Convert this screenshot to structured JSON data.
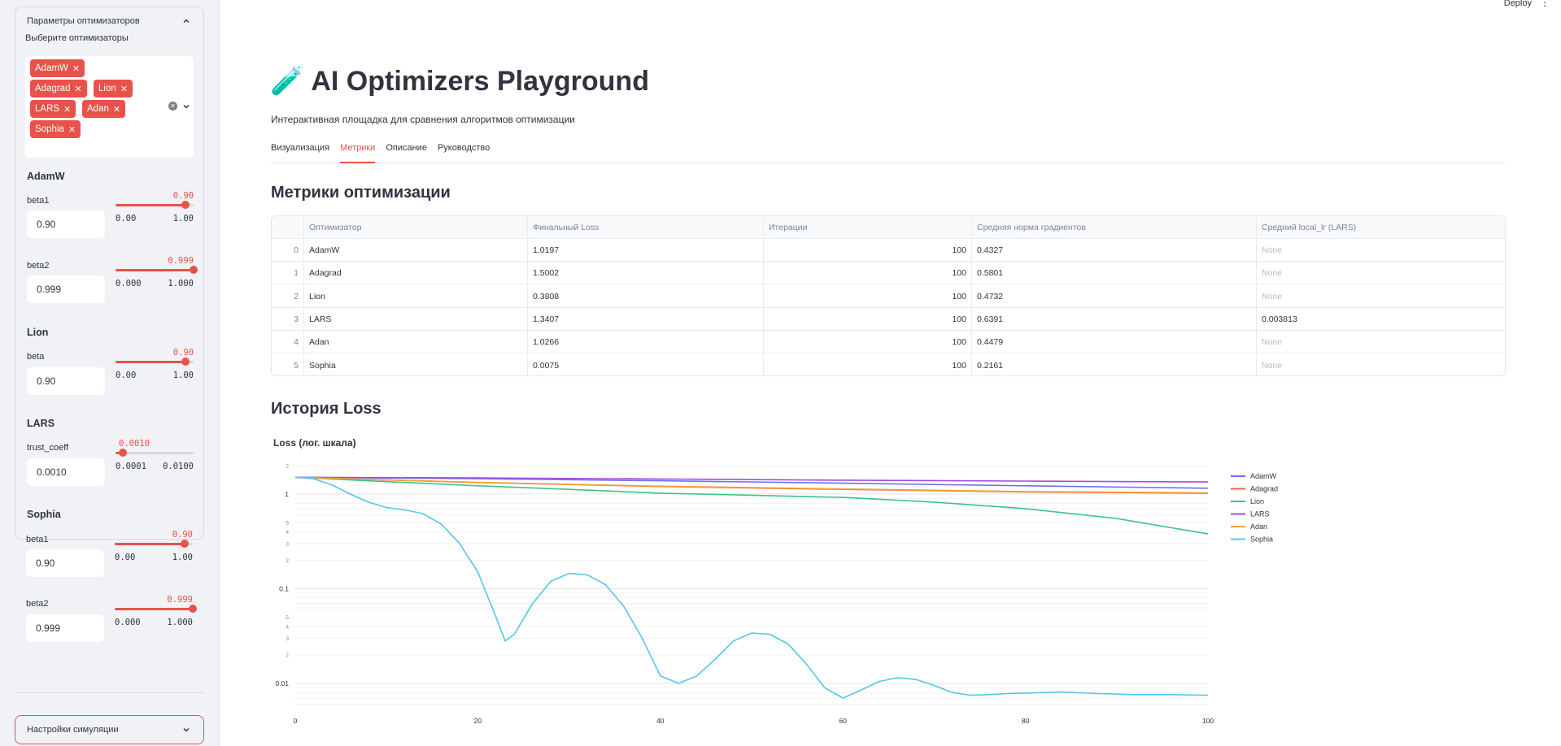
{
  "sidebar": {
    "expander_title": "Параметры оптимизаторов",
    "select_label": "Выберите оптимизаторы",
    "selected": [
      "AdamW",
      "Adagrad",
      "Lion",
      "LARS",
      "Adan",
      "Sophia"
    ],
    "groups": {
      "adamw": {
        "title": "AdamW",
        "beta1": {
          "label": "beta1",
          "value": "0.90",
          "slider_value": "0.90",
          "min": "0.00",
          "max": "1.00",
          "fraction": 0.9
        },
        "beta2": {
          "label": "beta2",
          "value": "0.999",
          "slider_value": "0.999",
          "min": "0.000",
          "max": "1.000",
          "fraction": 0.999
        }
      },
      "lion": {
        "title": "Lion",
        "beta": {
          "label": "beta",
          "value": "0.90",
          "slider_value": "0.90",
          "min": "0.00",
          "max": "1.00",
          "fraction": 0.9
        }
      },
      "lars": {
        "title": "LARS",
        "trust_coeff": {
          "label": "trust_coeff",
          "value": "0.0010",
          "slider_value": "0.0010",
          "min": "0.0001",
          "max": "0.0100",
          "fraction": 0.09
        }
      },
      "sophia": {
        "title": "Sophia",
        "beta1": {
          "label": "beta1",
          "value": "0.90",
          "slider_value": "0.90",
          "min": "0.00",
          "max": "1.00",
          "fraction": 0.9
        },
        "beta2": {
          "label": "beta2",
          "value": "0.999",
          "slider_value": "0.999",
          "min": "0.000",
          "max": "1.000",
          "fraction": 0.999
        }
      }
    },
    "sim_settings_title": "Настройки симуляции"
  },
  "header": {
    "deploy": "Deploy",
    "menu_icon": "⋮"
  },
  "main": {
    "title_icon": "🧪",
    "title": "AI Optimizers Playground",
    "subtitle": "Интерактивная площадка для сравнения алгоритмов оптимизации",
    "tabs": [
      {
        "label": "Визуализация"
      },
      {
        "label": "Метрики"
      },
      {
        "label": "Описание"
      },
      {
        "label": "Руководство"
      }
    ],
    "active_tab": 1,
    "metrics_heading": "Метрики оптимизации",
    "table": {
      "columns": [
        "",
        "Оптимизатор",
        "Финальный Loss",
        "Итерации",
        "Средняя норма градиентов",
        "Средний local_lr (LARS)"
      ],
      "rows": [
        [
          "0",
          "AdamW",
          "1.0197",
          "100",
          "0.4327",
          "None"
        ],
        [
          "1",
          "Adagrad",
          "1.5002",
          "100",
          "0.5801",
          "None"
        ],
        [
          "2",
          "Lion",
          "0.3808",
          "100",
          "0.4732",
          "None"
        ],
        [
          "3",
          "LARS",
          "1.3407",
          "100",
          "0.6391",
          "0.003813"
        ],
        [
          "4",
          "Adan",
          "1.0266",
          "100",
          "0.4479",
          "None"
        ],
        [
          "5",
          "Sophia",
          "0.0075",
          "100",
          "0.2161",
          "None"
        ]
      ]
    },
    "history_heading": "История Loss"
  },
  "chart_data": {
    "type": "line",
    "title": "Loss (лог. шкала)",
    "xlabel": "",
    "ylabel": "",
    "yscale": "log",
    "xlim": [
      0,
      100
    ],
    "ylim": [
      0.005,
      2.2
    ],
    "x_ticks": [
      "0",
      "20",
      "40",
      "60",
      "80",
      "100"
    ],
    "y_ticks_major": [
      "0.01",
      "0.1",
      "1"
    ],
    "y_ticks_minor_labels": [
      "2",
      "5",
      "3",
      "4"
    ],
    "legend_position": "right",
    "grid": true,
    "series": [
      {
        "name": "AdamW",
        "color": "#6b6ff2",
        "x": [
          0,
          20,
          40,
          60,
          80,
          100
        ],
        "y": [
          1.5,
          1.45,
          1.38,
          1.3,
          1.22,
          1.15
        ]
      },
      {
        "name": "Adagrad",
        "color": "#e8684a",
        "x": [
          0,
          20,
          40,
          60,
          80,
          100
        ],
        "y": [
          1.5,
          1.32,
          1.2,
          1.12,
          1.05,
          1.02
        ]
      },
      {
        "name": "Lion",
        "color": "#3cc486",
        "x": [
          0,
          10,
          20,
          30,
          40,
          50,
          60,
          70,
          80,
          90,
          100
        ],
        "y": [
          1.5,
          1.35,
          1.22,
          1.12,
          1.02,
          0.97,
          0.92,
          0.82,
          0.7,
          0.55,
          0.38
        ]
      },
      {
        "name": "LARS",
        "color": "#a64cdc",
        "x": [
          0,
          20,
          40,
          60,
          80,
          100
        ],
        "y": [
          1.5,
          1.48,
          1.44,
          1.4,
          1.37,
          1.34
        ]
      },
      {
        "name": "Adan",
        "color": "#f2a33a",
        "x": [
          0,
          20,
          40,
          60,
          80,
          100
        ],
        "y": [
          1.5,
          1.33,
          1.21,
          1.13,
          1.06,
          1.03
        ]
      },
      {
        "name": "Sophia",
        "color": "#54c6ea",
        "x": [
          0,
          2,
          4,
          6,
          8,
          10,
          12,
          14,
          16,
          18,
          20,
          22,
          23,
          24,
          26,
          28,
          30,
          32,
          34,
          36,
          38,
          40,
          42,
          44,
          46,
          48,
          50,
          52,
          54,
          56,
          58,
          60,
          62,
          64,
          66,
          68,
          70,
          72,
          74,
          76,
          78,
          80,
          84,
          88,
          92,
          96,
          100
        ],
        "y": [
          1.5,
          1.45,
          1.25,
          1.0,
          0.82,
          0.72,
          0.68,
          0.62,
          0.48,
          0.3,
          0.15,
          0.05,
          0.028,
          0.033,
          0.07,
          0.12,
          0.145,
          0.14,
          0.11,
          0.065,
          0.03,
          0.012,
          0.01,
          0.012,
          0.018,
          0.028,
          0.034,
          0.033,
          0.026,
          0.016,
          0.009,
          0.007,
          0.0085,
          0.0105,
          0.0115,
          0.011,
          0.0095,
          0.008,
          0.0075,
          0.0076,
          0.0078,
          0.0079,
          0.0081,
          0.0078,
          0.0076,
          0.0076,
          0.0075
        ]
      }
    ]
  }
}
